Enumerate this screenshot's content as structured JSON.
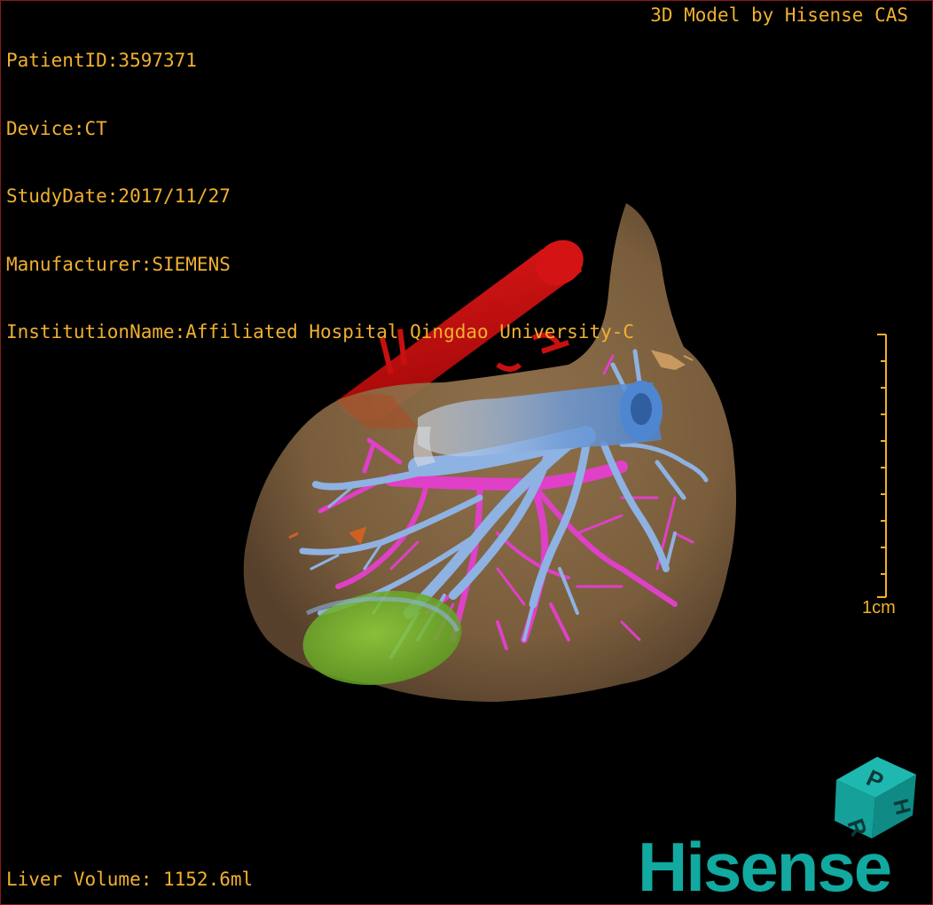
{
  "patient_info": {
    "patient_id": "PatientID:3597371",
    "device": "Device:CT",
    "study_date": "StudyDate:2017/11/27",
    "manufacturer": "Manufacturer:SIEMENS",
    "institution": "InstitutionName:Affiliated Hospital Qingdao University-C"
  },
  "vendor_credit": "3D Model by Hisense CAS",
  "liver_volume": "Liver Volume: 1152.6ml",
  "scale": {
    "label": "1cm"
  },
  "orientation_cube": {
    "faces": [
      "P",
      "R",
      "H"
    ]
  },
  "brand": "Hisense",
  "colors": {
    "overlay_text": "#f0b030",
    "liver": "#8a6a45",
    "artery": "#c81010",
    "portal_vein": "#7ea6dc",
    "hepatic_vein": "#e040c8",
    "lesion": "#7cc42e",
    "brand": "#11a9a0"
  }
}
